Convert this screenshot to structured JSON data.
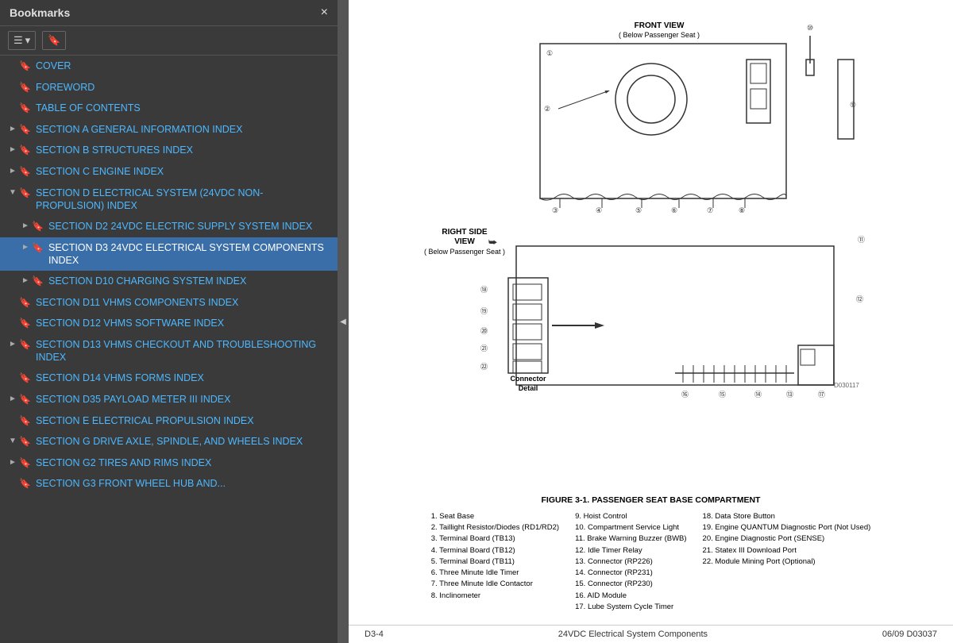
{
  "sidebar": {
    "title": "Bookmarks",
    "close_label": "×",
    "toolbar": {
      "expand_btn": "☰ ▾",
      "bookmark_btn": "🔖"
    },
    "items": [
      {
        "id": "cover",
        "label": "COVER",
        "level": 0,
        "expandable": false,
        "expanded": false,
        "active": false
      },
      {
        "id": "foreword",
        "label": "FOREWORD",
        "level": 0,
        "expandable": false,
        "expanded": false,
        "active": false
      },
      {
        "id": "toc",
        "label": "TABLE OF CONTENTS",
        "level": 0,
        "expandable": false,
        "expanded": false,
        "active": false
      },
      {
        "id": "section-a",
        "label": "SECTION A GENERAL INFORMATION INDEX",
        "level": 0,
        "expandable": true,
        "expanded": false,
        "active": false
      },
      {
        "id": "section-b",
        "label": "SECTION B STRUCTURES INDEX",
        "level": 0,
        "expandable": true,
        "expanded": false,
        "active": false
      },
      {
        "id": "section-c",
        "label": "SECTION C ENGINE INDEX",
        "level": 0,
        "expandable": true,
        "expanded": false,
        "active": false
      },
      {
        "id": "section-d",
        "label": "SECTION D ELECTRICAL SYSTEM (24VDC NON-PROPULSION) INDEX",
        "level": 0,
        "expandable": true,
        "expanded": true,
        "active": false
      },
      {
        "id": "section-d2",
        "label": "SECTION D2 24VDC ELECTRIC SUPPLY SYSTEM INDEX",
        "level": 1,
        "expandable": true,
        "expanded": false,
        "active": false
      },
      {
        "id": "section-d3",
        "label": "SECTION D3 24VDC ELECTRICAL SYSTEM COMPONENTS INDEX",
        "level": 1,
        "expandable": true,
        "expanded": false,
        "active": true
      },
      {
        "id": "section-d10",
        "label": "SECTION D10 CHARGING SYSTEM INDEX",
        "level": 1,
        "expandable": true,
        "expanded": false,
        "active": false
      },
      {
        "id": "section-d11",
        "label": "SECTION D11 VHMS COMPONENTS INDEX",
        "level": 0,
        "expandable": false,
        "expanded": false,
        "active": false
      },
      {
        "id": "section-d12",
        "label": "SECTION D12 VHMS SOFTWARE INDEX",
        "level": 0,
        "expandable": false,
        "expanded": false,
        "active": false
      },
      {
        "id": "section-d13",
        "label": "SECTION D13 VHMS CHECKOUT AND TROUBLESHOOTING INDEX",
        "level": 0,
        "expandable": true,
        "expanded": false,
        "active": false
      },
      {
        "id": "section-d14",
        "label": "SECTION D14 VHMS FORMS INDEX",
        "level": 0,
        "expandable": false,
        "expanded": false,
        "active": false
      },
      {
        "id": "section-d35",
        "label": "SECTION D35 PAYLOAD METER III INDEX",
        "level": 0,
        "expandable": true,
        "expanded": false,
        "active": false
      },
      {
        "id": "section-e",
        "label": "SECTION E ELECTRICAL PROPULSION INDEX",
        "level": 0,
        "expandable": false,
        "expanded": false,
        "active": false
      },
      {
        "id": "section-g",
        "label": "SECTION G DRIVE AXLE, SPINDLE, AND WHEELS INDEX",
        "level": 0,
        "expandable": true,
        "expanded": true,
        "active": false
      },
      {
        "id": "section-g2",
        "label": "SECTION G2 TIRES AND RIMS INDEX",
        "level": 0,
        "expandable": true,
        "expanded": false,
        "active": false
      },
      {
        "id": "section-g3",
        "label": "SECTION G3 FRONT WHEEL HUB AND...",
        "level": 0,
        "expandable": false,
        "expanded": false,
        "active": false
      }
    ]
  },
  "pdf": {
    "diagram_labels": {
      "front_view": "FRONT VIEW",
      "front_below": "( Below Passenger Seat )",
      "right_side": "RIGHT SIDE VIEW",
      "right_below": "( Below Passenger Seat )",
      "connector_detail": "Connector Detail",
      "figure_caption": "FIGURE 3-1. PASSENGER SEAT BASE COMPARTMENT",
      "diagram_ref": "D030117"
    },
    "legend": [
      {
        "num": "1",
        "text": "Seat Base"
      },
      {
        "num": "2",
        "text": "Taillight Resistor/Diodes (RD1/RD2)"
      },
      {
        "num": "3",
        "text": "Terminal Board (TB13)"
      },
      {
        "num": "4",
        "text": "Terminal Board (TB12)"
      },
      {
        "num": "5",
        "text": "Terminal Board (TB11)"
      },
      {
        "num": "6",
        "text": "Three Minute Idle Timer"
      },
      {
        "num": "7",
        "text": "Three Minute Idle Contactor"
      },
      {
        "num": "8",
        "text": "Inclinometer"
      },
      {
        "num": "9",
        "text": "Hoist Control"
      },
      {
        "num": "10",
        "text": "Compartment Service Light"
      },
      {
        "num": "11",
        "text": "Brake Warning Buzzer (BWB)"
      },
      {
        "num": "12",
        "text": "Idle Timer Relay"
      },
      {
        "num": "13",
        "text": "Connector (RP226)"
      },
      {
        "num": "14",
        "text": "Connector (RP231)"
      },
      {
        "num": "15",
        "text": "Connector (RP230)"
      },
      {
        "num": "16",
        "text": "AID Module"
      },
      {
        "num": "17",
        "text": "Lube System Cycle Timer"
      },
      {
        "num": "18",
        "text": "Data Store Button"
      },
      {
        "num": "19",
        "text": "Engine QUANTUM Diagnostic Port (Not Used)"
      },
      {
        "num": "20",
        "text": "Engine Diagnostic Port (SENSE)"
      },
      {
        "num": "21",
        "text": "Statex III Download Port"
      },
      {
        "num": "22",
        "text": "Module Mining Port (Optional)"
      }
    ],
    "footer": {
      "left": "D3-4",
      "center": "24VDC Electrical System Components",
      "right": "06/09  D03037"
    }
  }
}
